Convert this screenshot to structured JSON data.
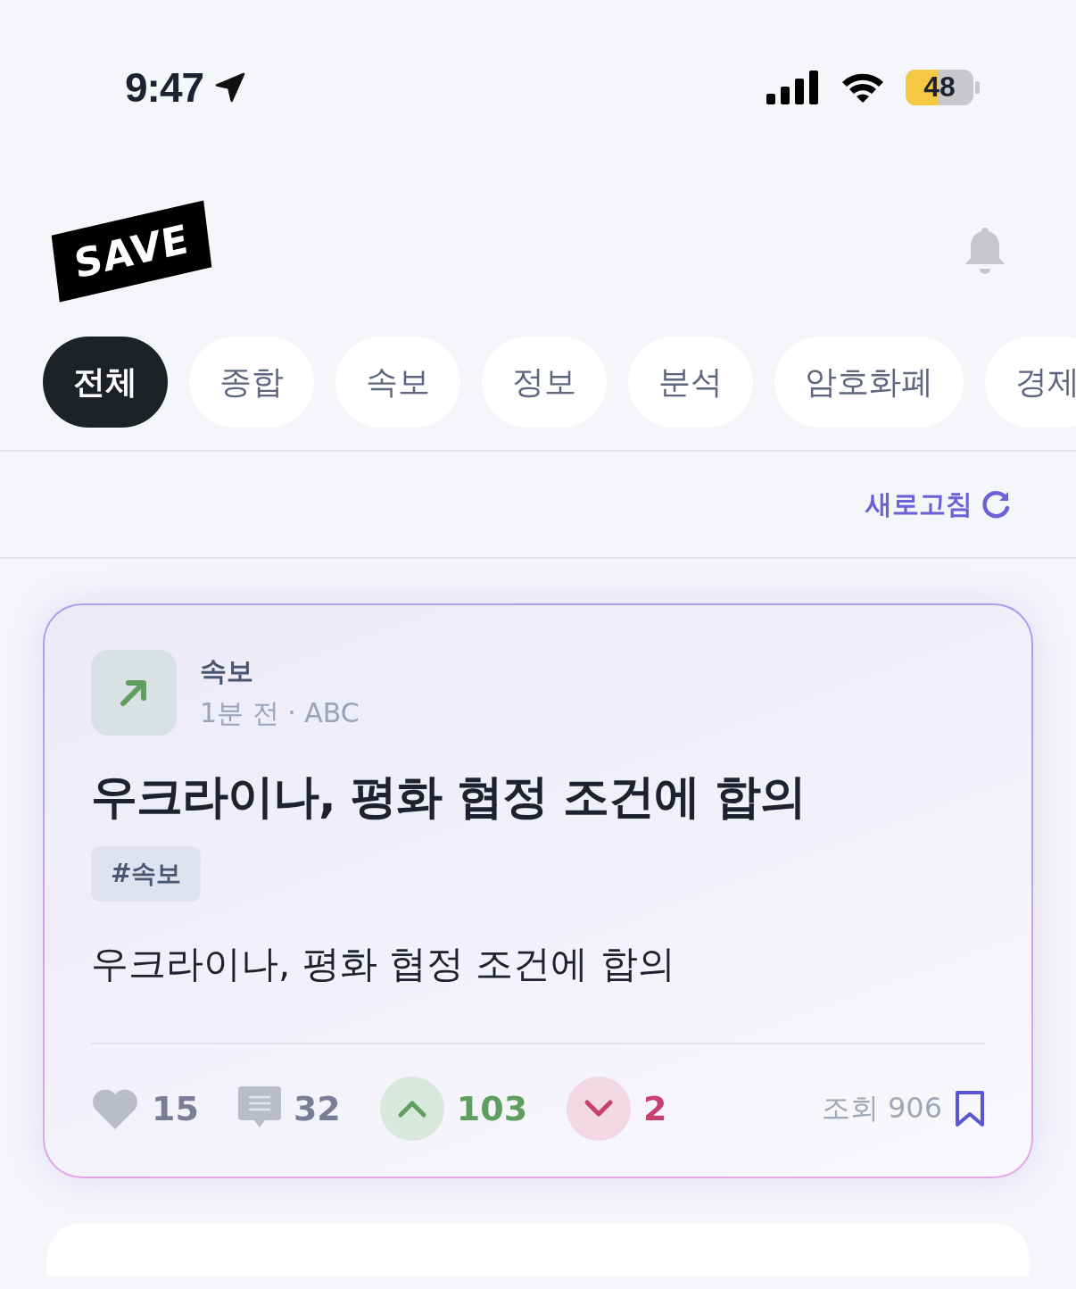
{
  "status_bar": {
    "time": "9:47",
    "battery": "48"
  },
  "header": {
    "logo": "SAVE"
  },
  "tabs": [
    {
      "label": "전체",
      "selected": true
    },
    {
      "label": "종합",
      "selected": false
    },
    {
      "label": "속보",
      "selected": false
    },
    {
      "label": "정보",
      "selected": false
    },
    {
      "label": "분석",
      "selected": false
    },
    {
      "label": "암호화폐",
      "selected": false
    },
    {
      "label": "경제",
      "selected": false
    }
  ],
  "refresh": {
    "label": "새로고침"
  },
  "card": {
    "category": "속보",
    "meta": "1분 전 · ABC",
    "title": "우크라이나, 평화 협정 조건에 합의",
    "tag": "#속보",
    "body": "우크라이나, 평화 협정 조건에 합의",
    "likes": "15",
    "comments": "32",
    "upvotes": "103",
    "downvotes": "2",
    "views": "조회 906"
  }
}
